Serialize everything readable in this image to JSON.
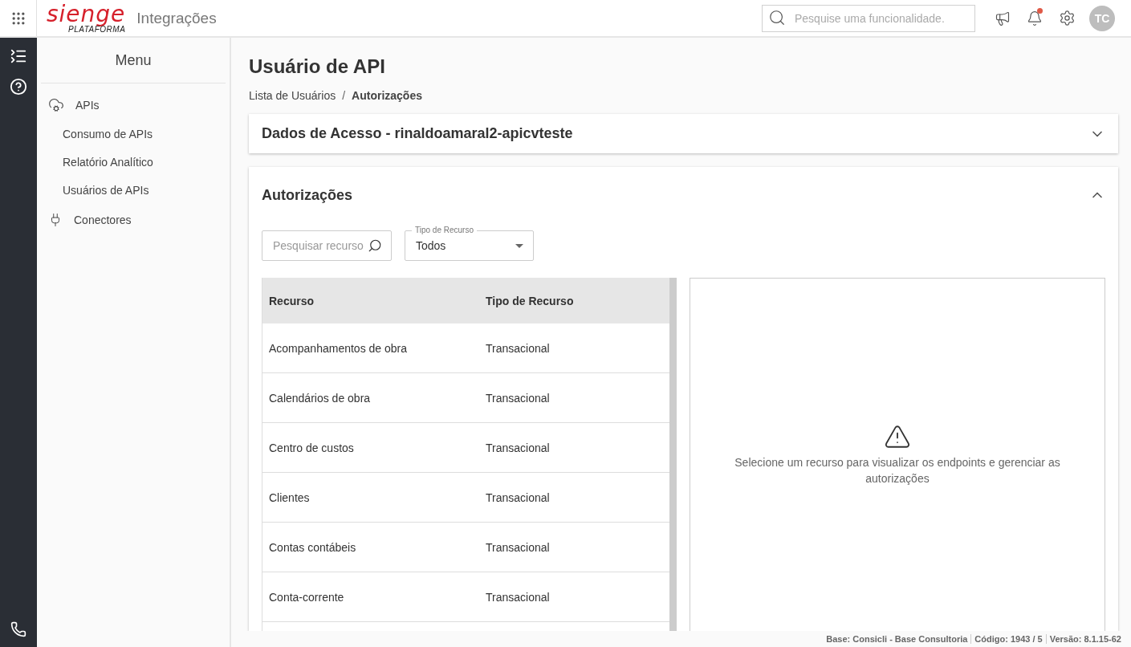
{
  "header": {
    "logo": "sienge",
    "logo_sub": "PLATAFORMA",
    "app_title": "Integrações",
    "search": {
      "placeholder": "Pesquise uma funcionalidade."
    },
    "notification_dot": true,
    "avatar": "TC"
  },
  "sidebar": {
    "title": "Menu",
    "items": [
      {
        "label": "APIs",
        "children": [
          {
            "label": "Consumo de APIs"
          },
          {
            "label": "Relatório Analítico"
          },
          {
            "label": "Usuários de APIs"
          }
        ]
      },
      {
        "label": "Conectores"
      }
    ]
  },
  "page": {
    "title": "Usuário de API",
    "breadcrumb_separator": "/",
    "breadcrumb": [
      {
        "label": "Lista de Usuários",
        "current": false
      },
      {
        "label": "Autorizações",
        "current": true
      }
    ],
    "access_panel": {
      "title": "Dados de Acesso - rinaldoamaral2-apicvteste",
      "expanded": false
    },
    "auth_panel": {
      "title": "Autorizações",
      "expanded": true,
      "search": {
        "placeholder": "Pesquisar recurso"
      },
      "type_select": {
        "label": "Tipo de Recurso",
        "value": "Todos"
      },
      "table": {
        "columns": [
          "Recurso",
          "Tipo de Recurso"
        ],
        "rows": [
          [
            "Acompanhamentos de obra",
            "Transacional"
          ],
          [
            "Calendários de obra",
            "Transacional"
          ],
          [
            "Centro de custos",
            "Transacional"
          ],
          [
            "Clientes",
            "Transacional"
          ],
          [
            "Contas contábeis",
            "Transacional"
          ],
          [
            "Conta-corrente",
            "Transacional"
          ]
        ]
      },
      "empty_message": "Selecione um recurso para visualizar os endpoints e gerenciar as autorizações"
    }
  },
  "status_bar": [
    "Base: Consicli - Base Consultoria",
    "Código: 1943 / 5",
    "Versão: 8.1.15-62"
  ]
}
